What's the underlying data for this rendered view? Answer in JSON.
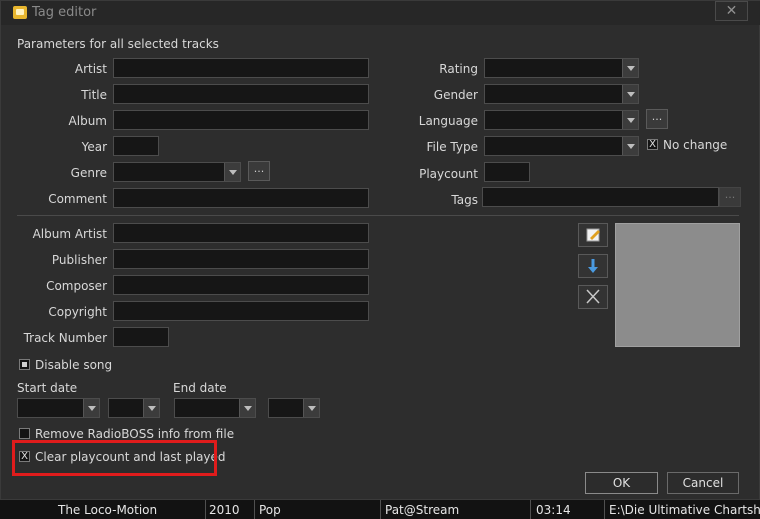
{
  "window": {
    "title": "Tag editor",
    "close_label": "✕"
  },
  "section_label": "Parameters for all selected tracks",
  "fields": {
    "artist": "Artist",
    "title": "Title",
    "album": "Album",
    "year": "Year",
    "genre": "Genre",
    "comment": "Comment",
    "rating": "Rating",
    "gender": "Gender",
    "language": "Language",
    "file_type": "File Type",
    "playcount": "Playcount",
    "tags": "Tags",
    "album_artist": "Album Artist",
    "publisher": "Publisher",
    "composer": "Composer",
    "copyright": "Copyright",
    "track_number": "Track Number"
  },
  "ellipsis": "...",
  "no_change": "No change",
  "disable_song": "Disable song",
  "start_date": "Start date",
  "end_date": "End date",
  "remove_info": "Remove RadioBOSS info from file",
  "clear_playcount": "Clear playcount and last played",
  "buttons": {
    "ok": "OK",
    "cancel": "Cancel"
  },
  "check_mark": "X",
  "track_row": {
    "title": "The Loco-Motion",
    "year": "2010",
    "genre": "Pop",
    "artist": "Pat@Stream",
    "duration": "03:14",
    "path": "E:\\Die Ultimative Chartshow\\"
  }
}
